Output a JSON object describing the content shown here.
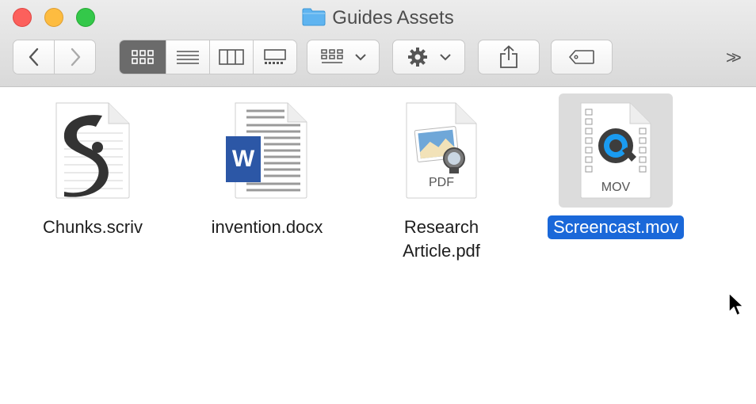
{
  "window": {
    "title": "Guides Assets"
  },
  "toolbar": {
    "back_icon": "chevron-left-icon",
    "forward_icon": "chevron-right-icon",
    "view_modes": [
      "icon-view-icon",
      "list-view-icon",
      "column-view-icon",
      "gallery-view-icon"
    ],
    "active_view": "icon-view-icon",
    "group_icon": "group-by-icon",
    "action_icon": "gear-icon",
    "share_icon": "share-icon",
    "tags_icon": "tag-icon",
    "overflow_label": ">>"
  },
  "files": [
    {
      "name": "Chunks.scriv",
      "icon": "scrivener-document-icon",
      "selected": false
    },
    {
      "name": "invention.docx",
      "icon": "word-document-icon",
      "selected": false
    },
    {
      "name": "Research Article.pdf",
      "icon": "pdf-document-icon",
      "type_label": "PDF",
      "selected": false
    },
    {
      "name": "Screencast.mov",
      "icon": "quicktime-movie-icon",
      "type_label": "MOV",
      "selected": true
    }
  ],
  "colors": {
    "selection": "#1a68d9",
    "close": "#fc605c",
    "minimize": "#fdbc40",
    "zoom": "#34c84a",
    "folder": "#5fb4f0"
  }
}
